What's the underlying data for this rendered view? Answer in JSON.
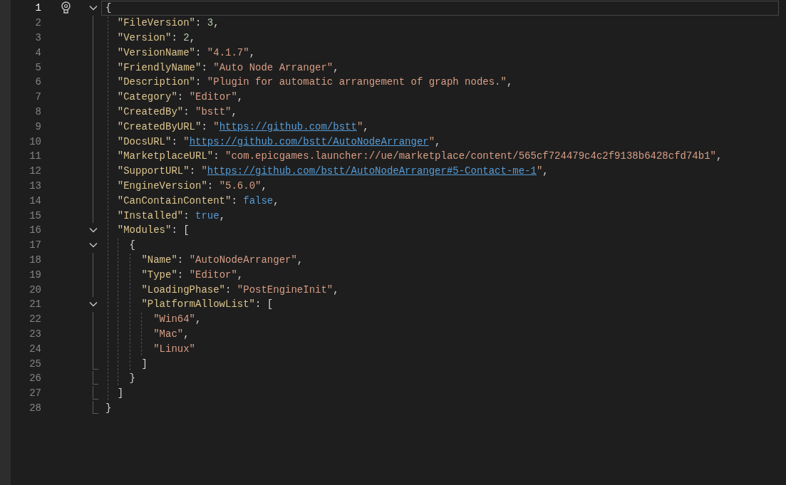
{
  "editor": {
    "lines": [
      {
        "number": "1",
        "current": true,
        "tokens": [
          {
            "kind": "p",
            "text": "{"
          }
        ],
        "children": [
          {
            "number": "2",
            "current": false,
            "tokens": [
              {
                "kind": "k",
                "text": "\"FileVersion\""
              },
              {
                "kind": "p",
                "text": ": "
              },
              {
                "kind": "n",
                "text": "3"
              },
              {
                "kind": "p",
                "text": ","
              }
            ]
          },
          {
            "number": "3",
            "current": false,
            "tokens": [
              {
                "kind": "k",
                "text": "\"Version\""
              },
              {
                "kind": "p",
                "text": ": "
              },
              {
                "kind": "n",
                "text": "2"
              },
              {
                "kind": "p",
                "text": ","
              }
            ]
          },
          {
            "number": "4",
            "current": false,
            "tokens": [
              {
                "kind": "k",
                "text": "\"VersionName\""
              },
              {
                "kind": "p",
                "text": ": "
              },
              {
                "kind": "s",
                "text": "\"4.1.7\""
              },
              {
                "kind": "p",
                "text": ","
              }
            ]
          },
          {
            "number": "5",
            "current": false,
            "tokens": [
              {
                "kind": "k",
                "text": "\"FriendlyName\""
              },
              {
                "kind": "p",
                "text": ": "
              },
              {
                "kind": "s",
                "text": "\"Auto Node Arranger\""
              },
              {
                "kind": "p",
                "text": ","
              }
            ]
          },
          {
            "number": "6",
            "current": false,
            "tokens": [
              {
                "kind": "k",
                "text": "\"Description\""
              },
              {
                "kind": "p",
                "text": ": "
              },
              {
                "kind": "s",
                "text": "\"Plugin for automatic arrangement of graph nodes.\""
              },
              {
                "kind": "p",
                "text": ","
              }
            ]
          },
          {
            "number": "7",
            "current": false,
            "tokens": [
              {
                "kind": "k",
                "text": "\"Category\""
              },
              {
                "kind": "p",
                "text": ": "
              },
              {
                "kind": "s",
                "text": "\"Editor\""
              },
              {
                "kind": "p",
                "text": ","
              }
            ]
          },
          {
            "number": "8",
            "current": false,
            "tokens": [
              {
                "kind": "k",
                "text": "\"CreatedBy\""
              },
              {
                "kind": "p",
                "text": ": "
              },
              {
                "kind": "s",
                "text": "\"bstt\""
              },
              {
                "kind": "p",
                "text": ","
              }
            ]
          },
          {
            "number": "9",
            "current": false,
            "tokens": [
              {
                "kind": "k",
                "text": "\"CreatedByURL\""
              },
              {
                "kind": "p",
                "text": ": "
              },
              {
                "kind": "s",
                "text": "\""
              },
              {
                "kind": "u",
                "text": "https://github.com/bstt"
              },
              {
                "kind": "s",
                "text": "\""
              },
              {
                "kind": "p",
                "text": ","
              }
            ]
          },
          {
            "number": "10",
            "current": false,
            "tokens": [
              {
                "kind": "k",
                "text": "\"DocsURL\""
              },
              {
                "kind": "p",
                "text": ": "
              },
              {
                "kind": "s",
                "text": "\""
              },
              {
                "kind": "u",
                "text": "https://github.com/bstt/AutoNodeArranger"
              },
              {
                "kind": "s",
                "text": "\""
              },
              {
                "kind": "p",
                "text": ","
              }
            ]
          },
          {
            "number": "11",
            "current": false,
            "tokens": [
              {
                "kind": "k",
                "text": "\"MarketplaceURL\""
              },
              {
                "kind": "p",
                "text": ": "
              },
              {
                "kind": "s",
                "text": "\"com.epicgames.launcher://ue/marketplace/content/565cf724479c4c2f9138b6428cfd74b1\""
              },
              {
                "kind": "p",
                "text": ","
              }
            ]
          },
          {
            "number": "12",
            "current": false,
            "tokens": [
              {
                "kind": "k",
                "text": "\"SupportURL\""
              },
              {
                "kind": "p",
                "text": ": "
              },
              {
                "kind": "s",
                "text": "\""
              },
              {
                "kind": "u",
                "text": "https://github.com/bstt/AutoNodeArranger#5-Contact-me-1"
              },
              {
                "kind": "s",
                "text": "\""
              },
              {
                "kind": "p",
                "text": ","
              }
            ]
          },
          {
            "number": "13",
            "current": false,
            "tokens": [
              {
                "kind": "k",
                "text": "\"EngineVersion\""
              },
              {
                "kind": "p",
                "text": ": "
              },
              {
                "kind": "s",
                "text": "\"5.6.0\""
              },
              {
                "kind": "p",
                "text": ","
              }
            ]
          },
          {
            "number": "14",
            "current": false,
            "tokens": [
              {
                "kind": "k",
                "text": "\"CanContainContent\""
              },
              {
                "kind": "p",
                "text": ": "
              },
              {
                "kind": "b",
                "text": "false"
              },
              {
                "kind": "p",
                "text": ","
              }
            ]
          },
          {
            "number": "15",
            "current": false,
            "tokens": [
              {
                "kind": "k",
                "text": "\"Installed\""
              },
              {
                "kind": "p",
                "text": ": "
              },
              {
                "kind": "b",
                "text": "true"
              },
              {
                "kind": "p",
                "text": ","
              }
            ]
          },
          {
            "number": "16",
            "current": false,
            "tokens": [
              {
                "kind": "k",
                "text": "\"Modules\""
              },
              {
                "kind": "p",
                "text": ": ["
              }
            ],
            "children": [
              {
                "number": "17",
                "current": false,
                "tokens": [
                  {
                    "kind": "p",
                    "text": "{"
                  }
                ],
                "children": [
                  {
                    "number": "18",
                    "current": false,
                    "tokens": [
                      {
                        "kind": "k",
                        "text": "\"Name\""
                      },
                      {
                        "kind": "p",
                        "text": ": "
                      },
                      {
                        "kind": "s",
                        "text": "\"AutoNodeArranger\""
                      },
                      {
                        "kind": "p",
                        "text": ","
                      }
                    ]
                  },
                  {
                    "number": "19",
                    "current": false,
                    "tokens": [
                      {
                        "kind": "k",
                        "text": "\"Type\""
                      },
                      {
                        "kind": "p",
                        "text": ": "
                      },
                      {
                        "kind": "s",
                        "text": "\"Editor\""
                      },
                      {
                        "kind": "p",
                        "text": ","
                      }
                    ]
                  },
                  {
                    "number": "20",
                    "current": false,
                    "tokens": [
                      {
                        "kind": "k",
                        "text": "\"LoadingPhase\""
                      },
                      {
                        "kind": "p",
                        "text": ": "
                      },
                      {
                        "kind": "s",
                        "text": "\"PostEngineInit\""
                      },
                      {
                        "kind": "p",
                        "text": ","
                      }
                    ]
                  },
                  {
                    "number": "21",
                    "current": false,
                    "tokens": [
                      {
                        "kind": "k",
                        "text": "\"PlatformAllowList\""
                      },
                      {
                        "kind": "p",
                        "text": ": ["
                      }
                    ],
                    "children": [
                      {
                        "number": "22",
                        "current": false,
                        "tokens": [
                          {
                            "kind": "s",
                            "text": "\"Win64\""
                          },
                          {
                            "kind": "p",
                            "text": ","
                          }
                        ]
                      },
                      {
                        "number": "23",
                        "current": false,
                        "tokens": [
                          {
                            "kind": "s",
                            "text": "\"Mac\""
                          },
                          {
                            "kind": "p",
                            "text": ","
                          }
                        ]
                      },
                      {
                        "number": "24",
                        "current": false,
                        "tokens": [
                          {
                            "kind": "s",
                            "text": "\"Linux\""
                          }
                        ]
                      }
                    ],
                    "closing": {
                      "number": "25",
                      "current": false,
                      "tokens": [
                        {
                          "kind": "p",
                          "text": "]"
                        }
                      ]
                    }
                  }
                ],
                "closing": {
                  "number": "26",
                  "current": false,
                  "tokens": [
                    {
                      "kind": "p",
                      "text": "}"
                    }
                  ]
                }
              }
            ],
            "closing": {
              "number": "27",
              "current": false,
              "tokens": [
                {
                  "kind": "p",
                  "text": "]"
                }
              ]
            }
          }
        ],
        "closing": {
          "number": "28",
          "current": false,
          "tokens": [
            {
              "kind": "p",
              "text": "}"
            }
          ]
        }
      }
    ]
  }
}
